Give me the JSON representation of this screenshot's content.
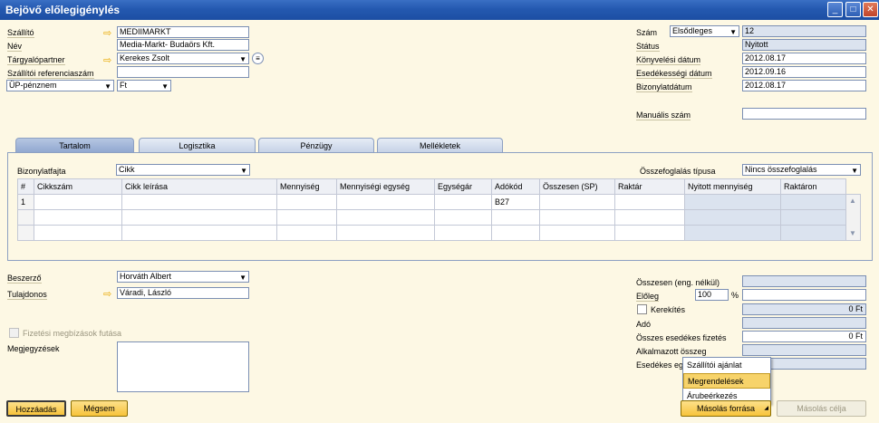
{
  "window": {
    "title": "Bejövő előlegigénylés"
  },
  "header_left": {
    "supplier_label": "Szállító",
    "supplier_value": "MEDIIMARKT",
    "name_label": "Név",
    "name_value": "Media-Markt- Budaörs Kft.",
    "contact_label": "Tárgyalópartner",
    "contact_value": "Kerekes Zsolt",
    "ref_label": "Szállítói referenciaszám",
    "ref_value": "",
    "currency_type": "ÜP-pénznem",
    "currency": "Ft"
  },
  "header_right": {
    "number_label": "Szám",
    "number_series": "Elsődleges",
    "number_value": "12",
    "status_label": "Státus",
    "status_value": "Nyitott",
    "posting_label": "Könyvelési dátum",
    "posting_value": "2012.08.17",
    "due_label": "Esedékességi dátum",
    "due_value": "2012.09.16",
    "docdate_label": "Bizonylatdátum",
    "docdate_value": "2012.08.17",
    "manual_label": "Manuális szám",
    "manual_value": ""
  },
  "tabs": [
    "Tartalom",
    "Logisztika",
    "Pénzügy",
    "Mellékletek"
  ],
  "content": {
    "doctype_label": "Bizonylatfajta",
    "doctype_value": "Cikk",
    "summary_label": "Összefoglalás típusa",
    "summary_value": "Nincs összefoglalás",
    "columns": [
      "#",
      "Cikkszám",
      "Cikk leírása",
      "Mennyiség",
      "Mennyiségi egység",
      "Egységár",
      "Adókód",
      "Összesen (SP)",
      "Raktár",
      "Nyitott mennyiség",
      "Raktáron"
    ],
    "rows": [
      [
        "1",
        "",
        "",
        "",
        "",
        "",
        "B27",
        "",
        "",
        "",
        ""
      ]
    ]
  },
  "footer_left": {
    "buyer_label": "Beszerző",
    "buyer_value": "Horváth Albert",
    "owner_label": "Tulajdonos",
    "owner_value": "Váradi, László",
    "payment_run_label": "Fizetési megbízások futása",
    "remarks_label": "Megjegyzések"
  },
  "footer_right": {
    "total_before_label": "Összesen (eng. nélkül)",
    "total_before_value": "",
    "advance_label": "Előleg",
    "advance_pct": "100",
    "pct_sign": "%",
    "rounding_label": "Kerekítés",
    "rounding_value": "0 Ft",
    "tax_label": "Adó",
    "tax_value": "",
    "total_due_label": "Összes esedékes fizetés",
    "total_due_value": "0 Ft",
    "applied_label": "Alkalmazott összeg",
    "applied_value": "",
    "balance_label": "Esedékes eg",
    "balance_value": ""
  },
  "buttons": {
    "add": "Hozzáadás",
    "cancel": "Mégsem",
    "copy_from": "Másolás forrása",
    "copy_to": "Másolás célja"
  },
  "copy_from_menu": [
    "Szállítói ajánlat",
    "Megrendelések",
    "Árubeérkezés"
  ]
}
